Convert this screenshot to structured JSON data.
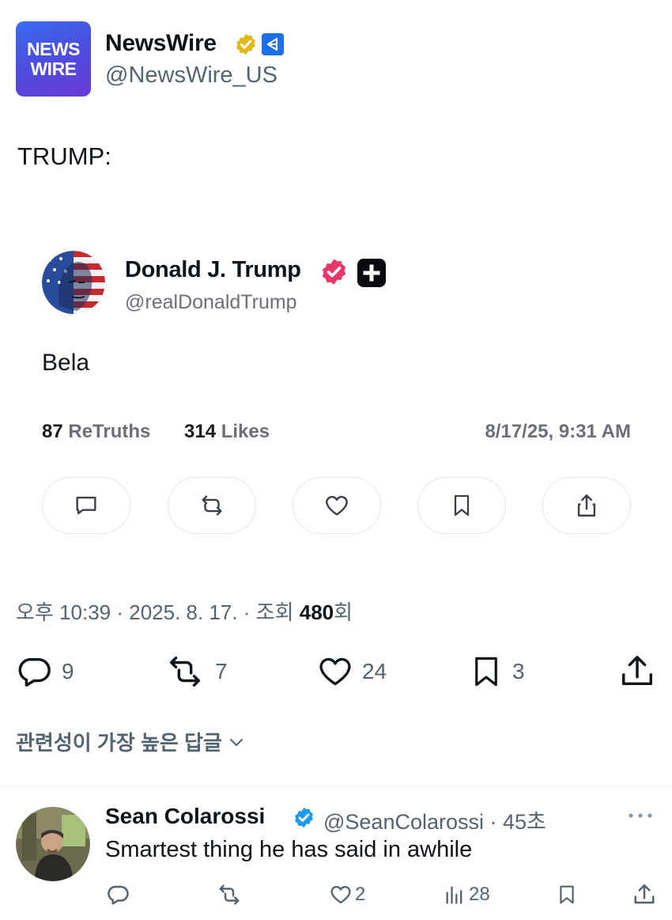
{
  "header": {
    "avatar_line1": "NEWS",
    "avatar_line2": "WIRE",
    "name": "NewsWire",
    "handle": "@NewsWire_US",
    "verified_badge": "gold-verified-icon"
  },
  "post": {
    "text": "TRUMP:"
  },
  "embed": {
    "name": "Donald J. Trump",
    "handle": "@realDonaldTrump",
    "text": "Bela",
    "retruths_count": "87",
    "retruths_label": "ReTruths",
    "likes_count": "314",
    "likes_label": "Likes",
    "date": "8/17/25, 9:31 AM",
    "buttons": [
      "reply-icon",
      "retruth-icon",
      "like-icon",
      "bookmark-icon",
      "share-icon"
    ]
  },
  "meta": {
    "time_date": "오후 10:39 · 2025. 8. 17. · 조회 ",
    "views": "480",
    "views_suffix": "회"
  },
  "actions": {
    "replies": "9",
    "reposts": "7",
    "likes": "24",
    "bookmarks": "3"
  },
  "sort": {
    "label": "관련성이 가장 높은 답글"
  },
  "reply": {
    "name": "Sean Colarossi",
    "handle": "@SeanColarossi · 45초",
    "text": "Smartest thing he has said in awhile",
    "likes": "2",
    "views": "28"
  },
  "colors": {
    "accent_blue": "#1d9bf0",
    "gold_badge": "#e2b719",
    "truth_badge": "#e8386a",
    "secondary_text": "#536471"
  }
}
